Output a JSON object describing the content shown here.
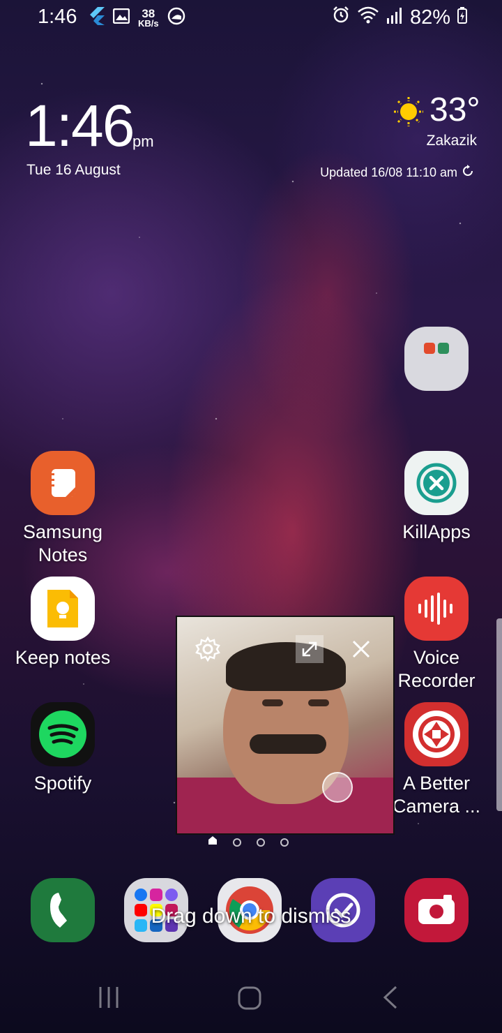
{
  "status_bar": {
    "time": "1:46",
    "network_speed_value": "38",
    "network_speed_unit": "KB/s",
    "battery": "82%",
    "icons_left": [
      "flutter-icon",
      "image-icon",
      "network-speed",
      "vpn-icon"
    ],
    "icons_right": [
      "alarm-icon",
      "wifi-icon",
      "signal-icon",
      "battery-icon"
    ]
  },
  "clock_widget": {
    "time": "1:46",
    "ampm": "pm",
    "date": "Tue 16 August"
  },
  "weather_widget": {
    "temperature": "33°",
    "city": "Zakazik",
    "updated": "Updated 16/08 11:10 am",
    "icon": "sun-icon"
  },
  "apps": {
    "folder": {
      "label": ""
    },
    "samsung_notes": {
      "label": "Samsung Notes",
      "color": "#e8602c"
    },
    "killapps": {
      "label": "KillApps",
      "color": "#1a9e8f"
    },
    "keep_notes": {
      "label": "Keep notes",
      "color": "#fbbc04"
    },
    "voice_recorder": {
      "label": "Voice Recorder",
      "color": "#e53935"
    },
    "spotify": {
      "label": "Spotify",
      "color": "#1ed760"
    },
    "better_camera": {
      "label": "A Better Camera ...",
      "color": "#d32f2f"
    }
  },
  "pip_window": {
    "controls": [
      "settings-icon",
      "expand-icon",
      "close-icon"
    ]
  },
  "page_indicator": {
    "pages": 4,
    "current": 1
  },
  "dock": {
    "apps": [
      "phone",
      "social-folder",
      "chrome",
      "tasks",
      "camera"
    ],
    "toast": "Drag down to dismiss"
  },
  "navbar": [
    "recents-button",
    "home-button",
    "back-button"
  ]
}
